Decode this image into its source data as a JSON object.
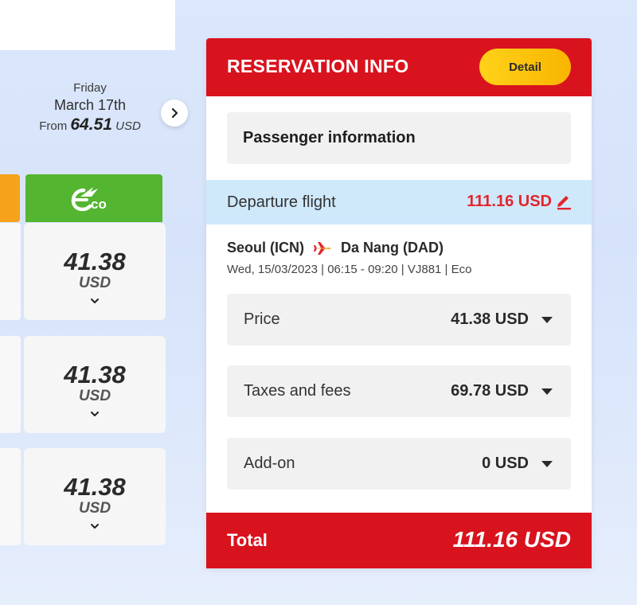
{
  "date_nav": {
    "day": "Friday",
    "month_day": "March 17th",
    "from_label": "From",
    "price": "64.51",
    "currency": "USD"
  },
  "fare_class": {
    "eco_icon": "eco-logo-icon",
    "eco_color": "#54b530",
    "other_color": "#f7a21b"
  },
  "fares": [
    {
      "amount": "41.38",
      "currency": "USD"
    },
    {
      "amount": "41.38",
      "currency": "USD"
    },
    {
      "amount": "41.38",
      "currency": "USD"
    }
  ],
  "reservation": {
    "title": "RESERVATION INFO",
    "detail_label": "Detail",
    "passenger_label": "Passenger information",
    "departure": {
      "label": "Departure flight",
      "amount": "111.16 USD"
    },
    "route": {
      "origin": "Seoul (ICN)",
      "destination": "Da Nang (DAD)",
      "meta": "Wed, 15/03/2023 | 06:15 - 09:20 | VJ881 | Eco"
    },
    "fees": [
      {
        "label": "Price",
        "value": "41.38 USD"
      },
      {
        "label": "Taxes and fees",
        "value": "69.78 USD"
      },
      {
        "label": "Add-on",
        "value": "0 USD"
      }
    ],
    "total": {
      "label": "Total",
      "amount": "111.16 USD"
    }
  },
  "colors": {
    "brand_red": "#d8131e",
    "accent_red": "#e4252d",
    "detail_yellow": "#ffc20e",
    "departure_bg": "#cfe9fb"
  }
}
